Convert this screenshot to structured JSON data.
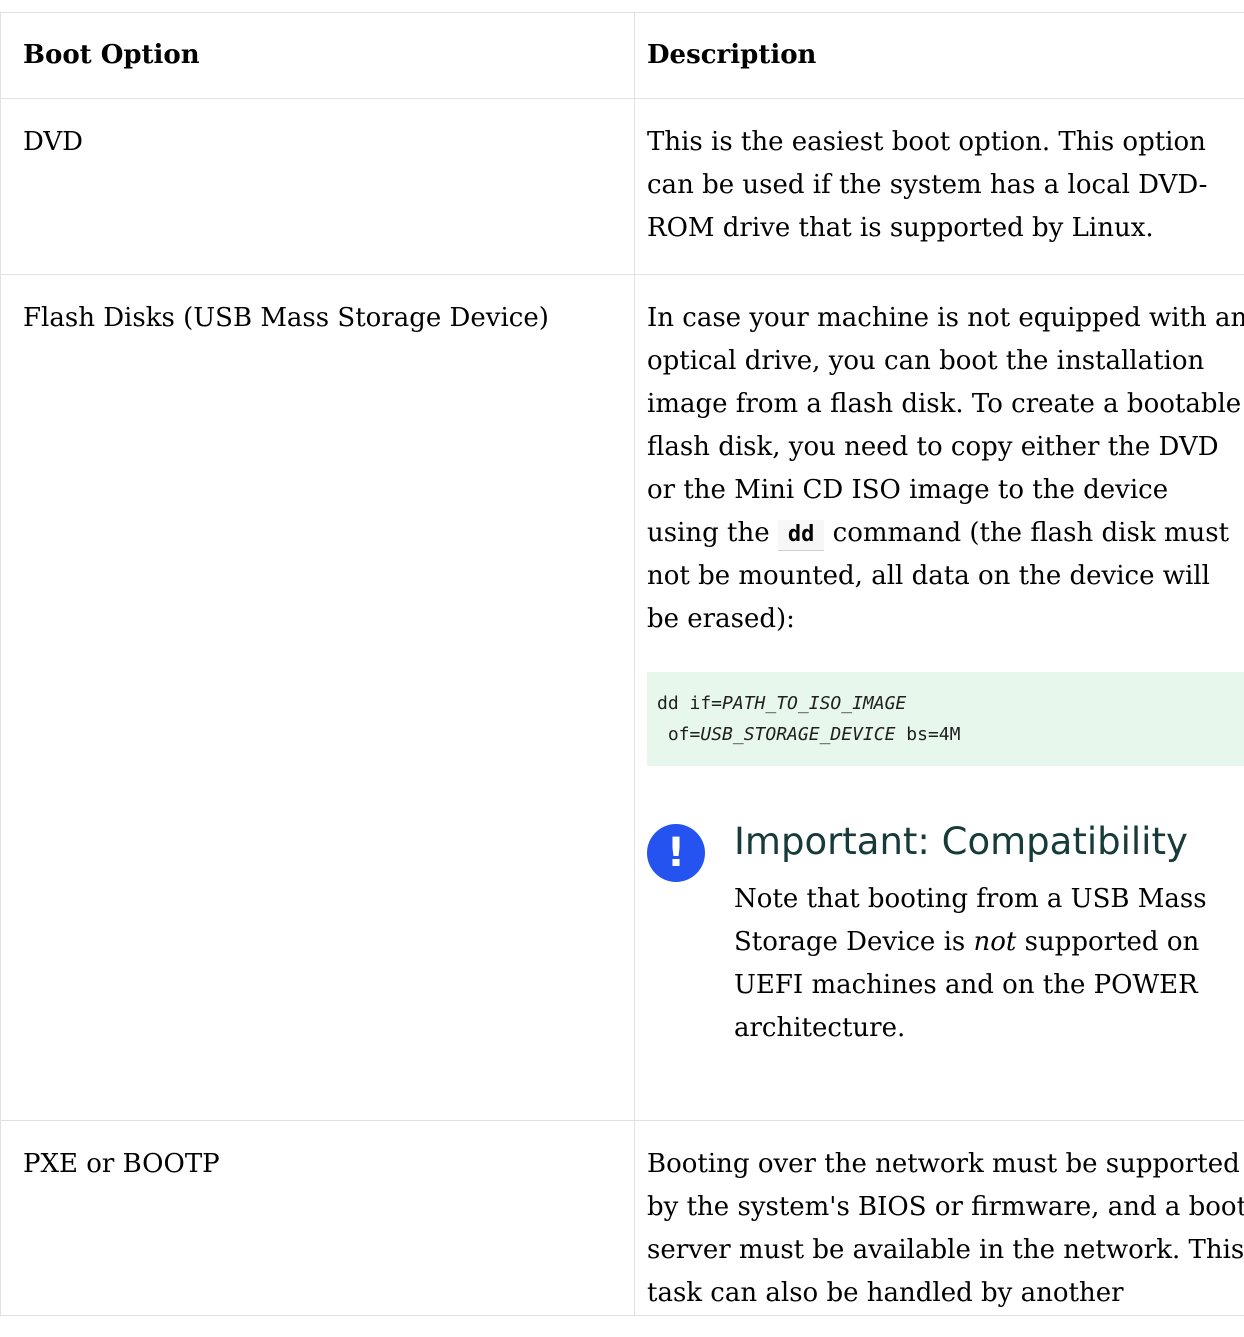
{
  "table": {
    "headers": {
      "option": "Boot Option",
      "description": "Description"
    },
    "rows": {
      "dvd": {
        "option": "DVD",
        "description": "This is the easiest boot option. This option can be used if the system has a local DVD-ROM drive that is supported by Linux."
      },
      "flash": {
        "option": "Flash Disks (USB Mass Storage Device)",
        "description_before": "In case your machine is not equipped with an optical drive, you can boot the installation image from a flash disk. To create a bootable flash disk, you need to copy either the DVD or the Mini CD ISO image to the device using the",
        "command": "dd",
        "description_after": "command (the flash disk must not be mounted, all data on the device will be erased):",
        "code": {
          "line1_prefix": "dd if=",
          "line1_var": "PATH_TO_ISO_IMAGE",
          "line2_prefix": " of=",
          "line2_var": "USB_STORAGE_DEVICE",
          "line2_suffix": " bs=4M"
        },
        "admonition": {
          "icon": "exclamation-icon",
          "icon_glyph": "!",
          "title": "Important: Compatibility",
          "body_before": "Note that booting from a USB Mass Storage Device is ",
          "body_emphasis": "not",
          "body_after": " supported on UEFI machines and on the POWER architecture."
        }
      },
      "pxe": {
        "option": "PXE or BOOTP",
        "description": "Booting over the network must be supported by the system's BIOS or firmware, and a boot server must be available in the network. This task can also be handled by another"
      }
    }
  },
  "colors": {
    "admonition_icon": "#2453f0",
    "code_background": "#e8f7ec",
    "admonition_title": "#173a3a",
    "border": "#e1e1e1"
  }
}
